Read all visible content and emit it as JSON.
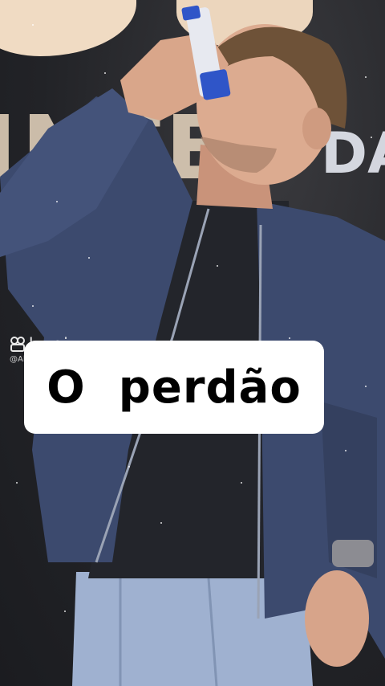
{
  "video": {
    "caption": "O  perdão",
    "stage_text": "INTE",
    "stage_text_right": "DA"
  },
  "watermark": {
    "brand": "kwai",
    "handle": "@AlinprovaDuda",
    "icon": "kwai-logo-icon"
  },
  "colors": {
    "caption_bg": "#ffffff",
    "caption_text": "#000000",
    "jacket": "#3c4a6e",
    "shirt": "#23252b",
    "jeans": "#9fb1d0",
    "skin": "#d9a68a",
    "bottle": "#2f55c8"
  }
}
